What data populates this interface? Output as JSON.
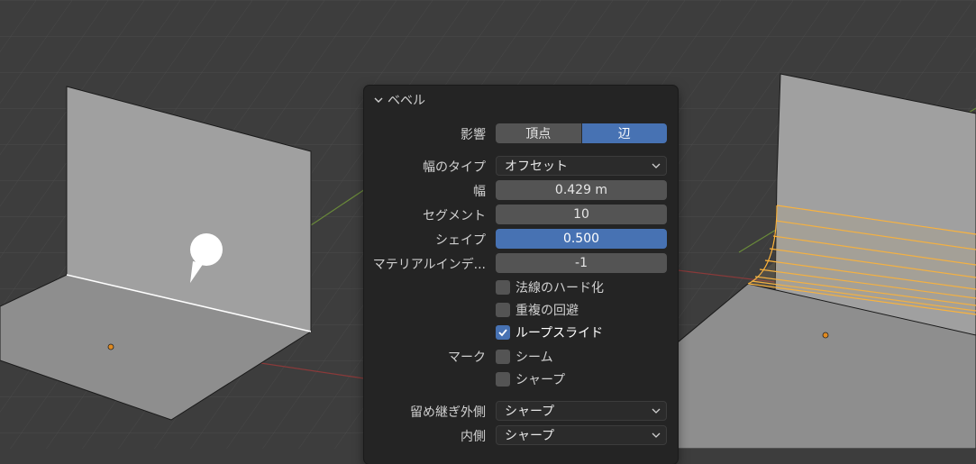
{
  "panel": {
    "title": "ベベル",
    "affect": {
      "label": "影響",
      "options": [
        "頂点",
        "辺"
      ],
      "selected": "辺"
    },
    "width_type": {
      "label": "幅のタイプ",
      "value": "オフセット"
    },
    "width": {
      "label": "幅",
      "value": "0.429 m"
    },
    "segments": {
      "label": "セグメント",
      "value": "10"
    },
    "shape": {
      "label": "シェイプ",
      "value": "0.500",
      "fill": 1.0
    },
    "material_index": {
      "label": "マテリアルインデ...",
      "value": "-1"
    },
    "harden_normals": {
      "label": "法線のハード化",
      "checked": false
    },
    "clamp_overlap": {
      "label": "重複の回避",
      "checked": false
    },
    "loop_slide": {
      "label": "ループスライド",
      "checked": true
    },
    "mark": {
      "label": "マーク",
      "seam": {
        "label": "シーム",
        "checked": false
      },
      "sharp": {
        "label": "シャープ",
        "checked": false
      }
    },
    "miter_outer": {
      "label": "留め継ぎ外側",
      "value": "シャープ"
    },
    "miter_inner": {
      "label": "内側",
      "value": "シャープ"
    }
  },
  "colors": {
    "accent": "#4772b3",
    "selection": "#ffb43a",
    "background": "#3d3d3d",
    "panel": "#242424"
  },
  "icons": [
    "chevron-down-icon",
    "checkmark-icon",
    "caret-down-icon",
    "pointer-cursor-icon"
  ]
}
